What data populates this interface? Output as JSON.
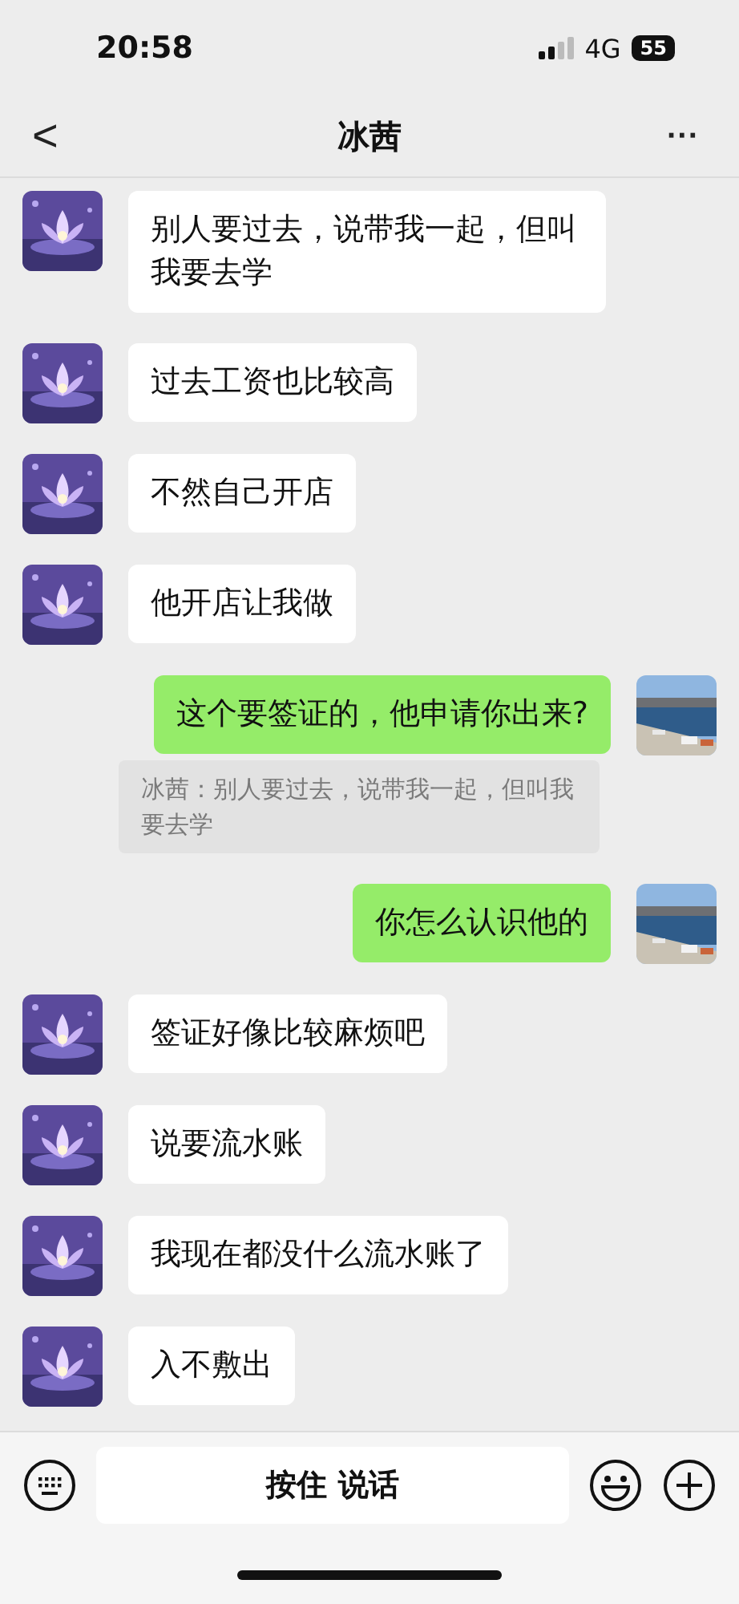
{
  "status_bar": {
    "time": "20:58",
    "network": "4G",
    "battery": "55"
  },
  "header": {
    "back": "<",
    "title": "冰茜",
    "more": "···"
  },
  "messages": [
    {
      "kind": "received",
      "text": "别人要过去，说带我一起，但叫我要去学"
    },
    {
      "kind": "received",
      "text": "过去工资也比较高"
    },
    {
      "kind": "received",
      "text": "不然自己开店"
    },
    {
      "kind": "received",
      "text": "他开店让我做"
    },
    {
      "kind": "sent",
      "text": "这个要签证的，他申请你出来?"
    },
    {
      "kind": "quote",
      "text": "冰茜：别人要过去，说带我一起，但叫我要去学"
    },
    {
      "kind": "sent",
      "text": "你怎么认识他的"
    },
    {
      "kind": "received",
      "text": "签证好像比较麻烦吧"
    },
    {
      "kind": "received",
      "text": "说要流水账"
    },
    {
      "kind": "received",
      "text": "我现在都没什么流水账了"
    },
    {
      "kind": "received",
      "text": "入不敷出"
    }
  ],
  "input_bar": {
    "hold_to_talk": "按住 说话"
  }
}
